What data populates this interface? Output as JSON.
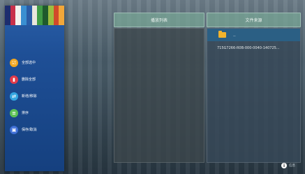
{
  "banner_colors": [
    "#1d2d6e",
    "#c8304a",
    "#f4f2ee",
    "#3a8fd1",
    "#2a5ca6",
    "#e9e6dd",
    "#3f9b45",
    "#1f5a2c",
    "#9dbd40",
    "#d24a2a",
    "#f2a73a"
  ],
  "menu": {
    "items": [
      {
        "name": "select-all",
        "icon": "select-all-icon",
        "icon_color": "#f2a720",
        "label": "全部选中"
      },
      {
        "name": "delete-all",
        "icon": "trash-icon",
        "icon_color": "#e23b4a",
        "label": "删除全部"
      },
      {
        "name": "add-remove",
        "icon": "swap-icon",
        "icon_color": "#35a6e0",
        "label": "新增/移除"
      },
      {
        "name": "sort",
        "icon": "sort-icon",
        "icon_color": "#5cc155",
        "label": "排序"
      },
      {
        "name": "save-cancel",
        "icon": "save-icon",
        "icon_color": "#3f6fd6",
        "label": "保存/取消"
      }
    ]
  },
  "header": {
    "playlist": "播放列表",
    "file_source": "文件来源"
  },
  "file_list": {
    "parent_folder": "..",
    "entries": [
      "715G7266-R0B-000-0040-140725..."
    ]
  },
  "footer": {
    "help_icon": "i",
    "help_label": "信息"
  }
}
